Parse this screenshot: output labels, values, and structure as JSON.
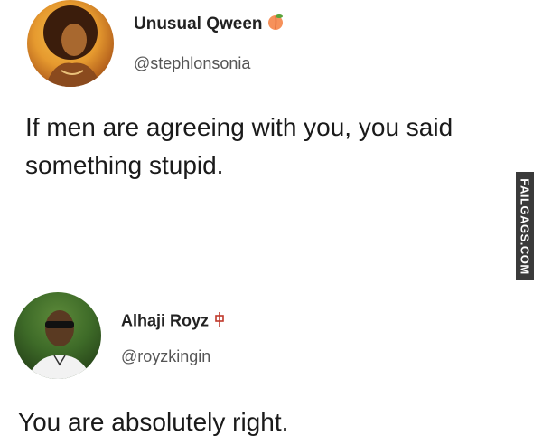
{
  "tweets": [
    {
      "display_name": "Unusual Qween",
      "name_emoji_icon": "peach-icon",
      "handle": "@stephlonsonia",
      "text_line1": "If men are agreeing with you, you said",
      "text_line2": "something stupid."
    },
    {
      "display_name": "Alhaji Royz",
      "name_emoji_icon": "mahjong-red-dragon-icon",
      "handle": "@royzkingin",
      "text_line1": "You are absolutely right."
    }
  ],
  "watermark": {
    "text": "FAILGAGS.COM",
    "bg_color": "#3a3a3a"
  }
}
